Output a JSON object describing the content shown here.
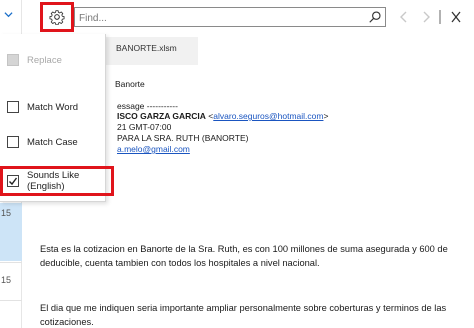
{
  "find_bar": {
    "placeholder": "Find...",
    "search_icon": "search-icon",
    "settings_icon": "gear-icon"
  },
  "message_list": {
    "dates": [
      "15",
      "15"
    ]
  },
  "options_menu": {
    "items": [
      {
        "label": "Replace",
        "checked": false,
        "disabled": true
      },
      {
        "label": "Match Word",
        "checked": false,
        "disabled": false
      },
      {
        "label": "Match Case",
        "checked": false,
        "disabled": false
      },
      {
        "label": "Sounds Like (English)",
        "checked": true,
        "disabled": false
      }
    ]
  },
  "email": {
    "attachment_name": "BANORTE.xlsm",
    "subject_fragment": "Banorte",
    "header_lines": {
      "original_message": "essage -----------",
      "from_name": "ISCO GARZA GARCIA",
      "from_email": "alvaro.seguros@hotmail.com",
      "sent": "21 GMT-07:00",
      "to": "PARA LA SRA. RUTH (BANORTE)",
      "cc_email": "a.melo@gmail.com"
    },
    "body": [
      "Esta es la cotizacion en Banorte de la Sra. Ruth, es con 100 millones de suma asegurada y 600 de deducible, cuenta tambien con todos los hospitales a nivel nacional.",
      "El dia que me indiquen seria importante ampliar personalmente sobre coberturas y terminos de las cotizaciones."
    ]
  },
  "colors": {
    "highlight_border": "#e0141b",
    "link": "#1a55c0",
    "selection": "#cde4f7"
  }
}
